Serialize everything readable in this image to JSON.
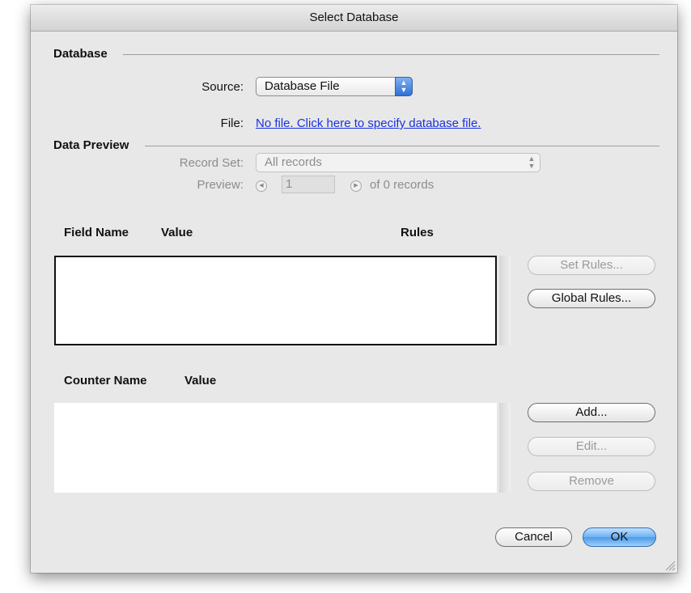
{
  "window": {
    "title": "Select Database"
  },
  "database_group": {
    "label": "Database",
    "source_label": "Source:",
    "source_value": "Database File",
    "file_label": "File:",
    "file_link": "No file. Click here to specify database file."
  },
  "preview_group": {
    "label": "Data Preview",
    "record_set_label": "Record Set:",
    "record_set_value": "All records",
    "preview_label": "Preview:",
    "preview_value": "1",
    "records_text": "of 0 records"
  },
  "fields_table": {
    "columns": [
      "Field Name",
      "Value",
      "Rules"
    ],
    "rows": []
  },
  "field_buttons": {
    "set_rules": "Set Rules...",
    "global_rules": "Global Rules..."
  },
  "counters_table": {
    "columns": [
      "Counter Name",
      "Value"
    ],
    "rows": []
  },
  "counter_buttons": {
    "add": "Add...",
    "edit": "Edit...",
    "remove": "Remove"
  },
  "footer": {
    "cancel": "Cancel",
    "ok": "OK"
  },
  "colors": {
    "link": "#1a32e0",
    "default_button": "#6cb0f2",
    "window_bg": "#e8e8e8"
  }
}
